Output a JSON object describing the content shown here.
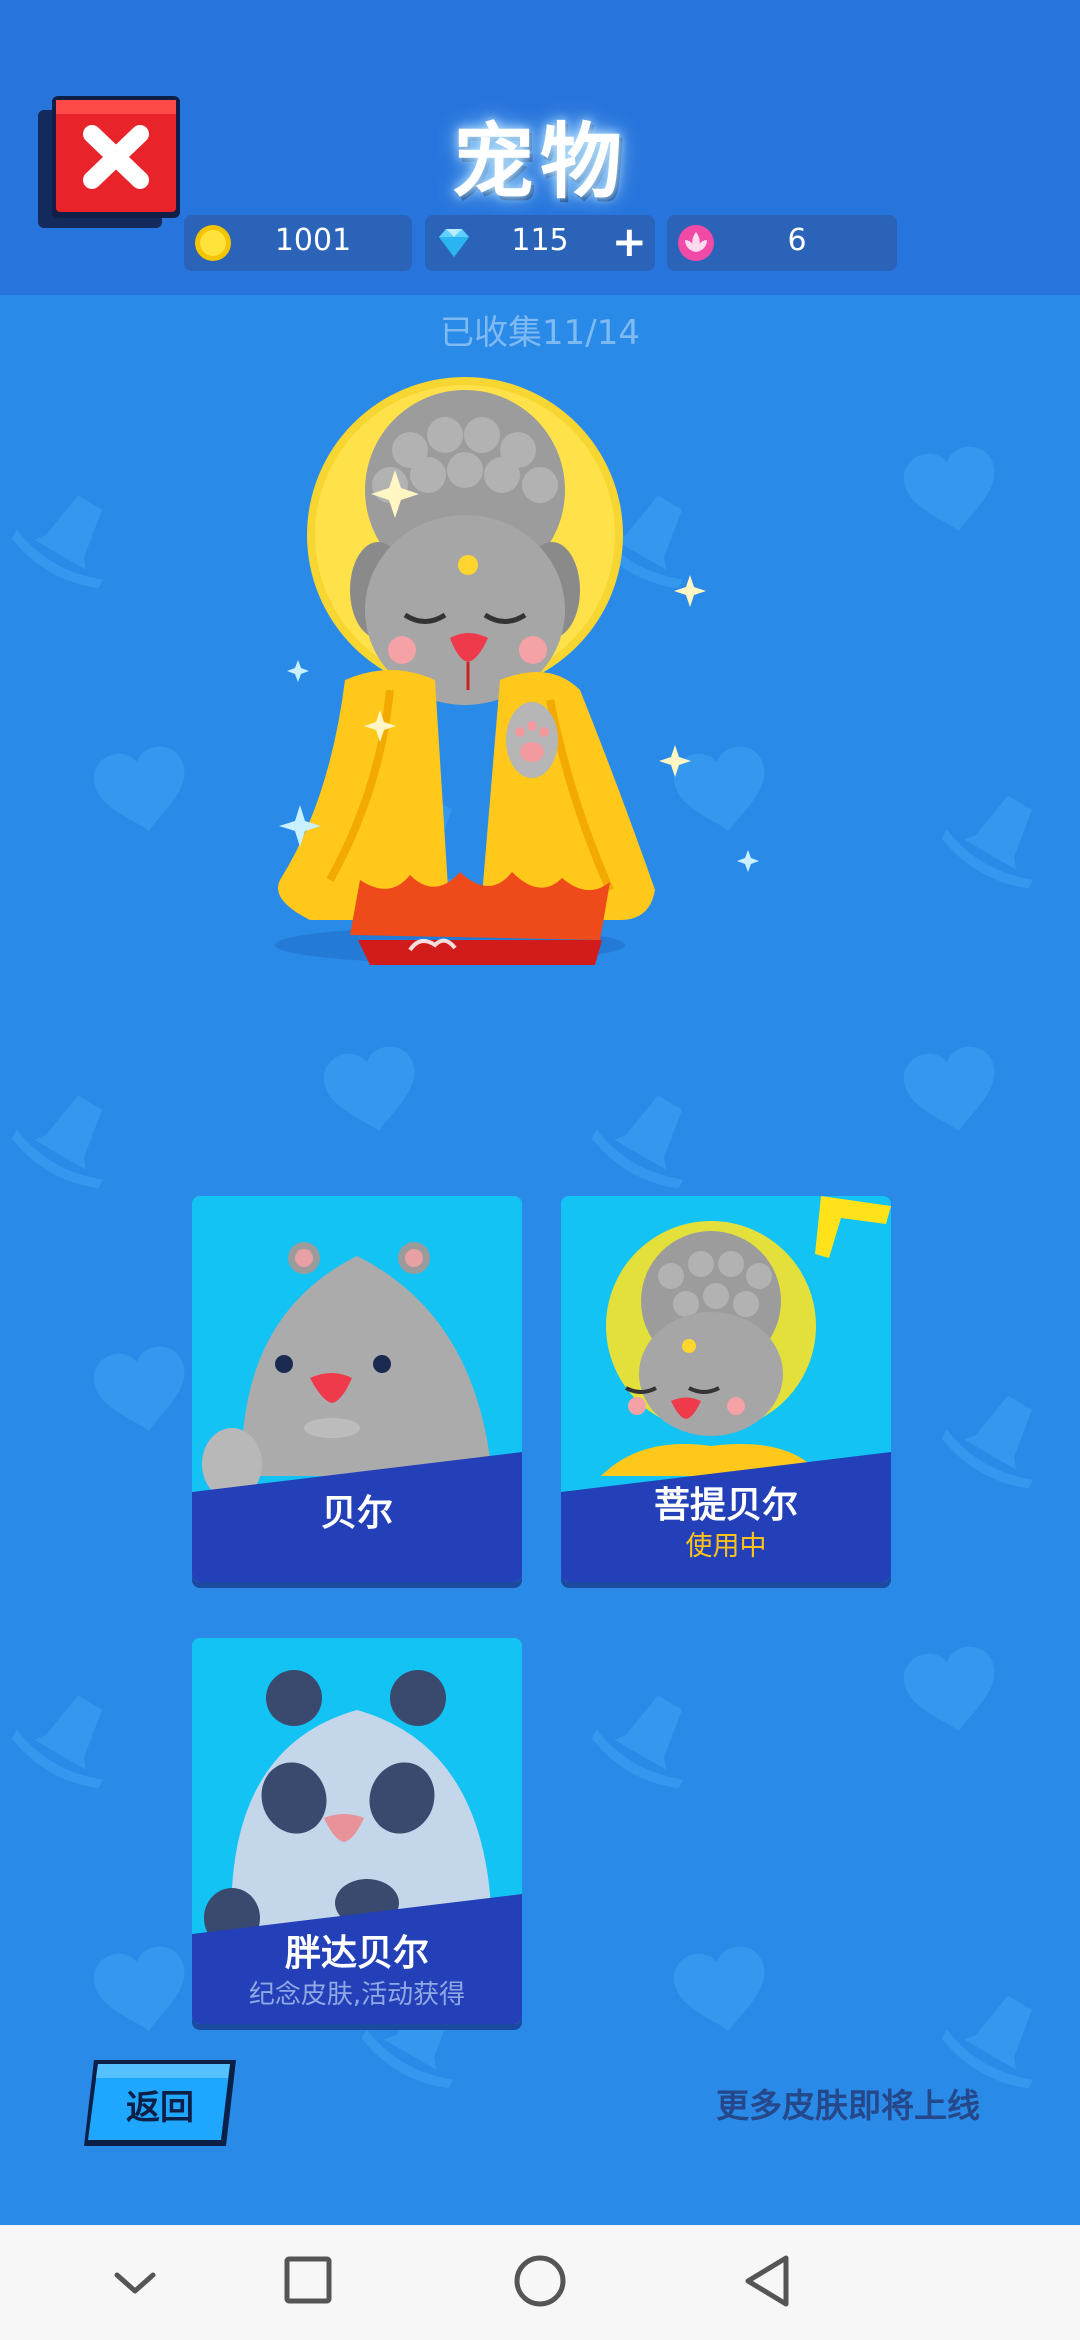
{
  "header": {
    "title": "宠物",
    "resources": {
      "coins": "1001",
      "diamonds": "115",
      "lotus": "6"
    }
  },
  "collected_text": "已收集11/14",
  "pets": [
    {
      "name": "贝尔",
      "status": ""
    },
    {
      "name": "菩提贝尔",
      "status": "使用中"
    },
    {
      "name": "胖达贝尔",
      "status": "纪念皮肤,活动获得"
    }
  ],
  "footer": {
    "back_label": "返回",
    "more_skins_text": "更多皮肤即将上线"
  },
  "colors": {
    "header_bg": "#2774dc",
    "page_bg": "#2a8ae8",
    "card_bg": "#0fc6f4",
    "card_band": "#2440b8",
    "in_use_text": "#ffc21a",
    "close_red": "#e8232a"
  },
  "icons": {
    "close": "close-icon",
    "coin": "coin-icon",
    "diamond": "diamond-icon",
    "lotus": "lotus-icon",
    "plus": "plus-icon"
  }
}
